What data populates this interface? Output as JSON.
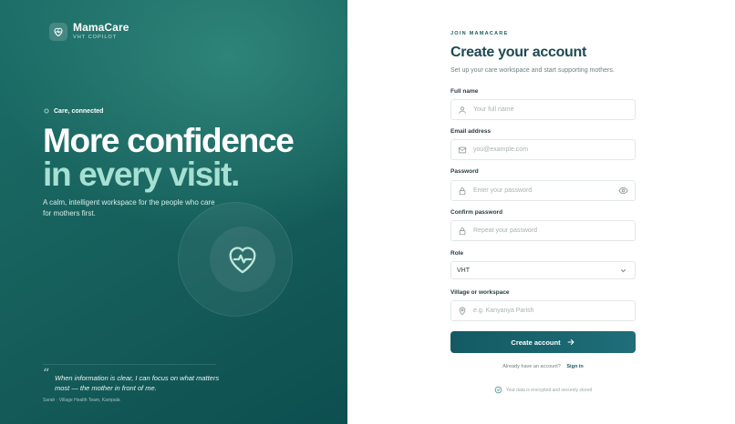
{
  "brand": {
    "name": "MamaCare",
    "subtitle": "VHT COPILOT"
  },
  "hero": {
    "eyebrow": "Care, connected",
    "headline_line1": "More confidence",
    "headline_line2": "in every visit.",
    "lead": "A calm, intelligent workspace for the people who care for mothers first.",
    "quote": "When information is clear, I can focus on what matters most — the mother in front of me.",
    "attribution": "Sarah · Village Health Team, Kampala"
  },
  "form": {
    "kicker": "JOIN MAMACARE",
    "title": "Create your account",
    "subtitle": "Set up your care workspace and start supporting mothers.",
    "full_name": {
      "label": "Full name",
      "placeholder": "Your full name"
    },
    "email": {
      "label": "Email address",
      "placeholder": "you@example.com"
    },
    "password": {
      "label": "Password",
      "placeholder": "Enter your password"
    },
    "confirm_password": {
      "label": "Confirm password",
      "placeholder": "Repeat your password"
    },
    "role": {
      "label": "Role",
      "value": "VHT"
    },
    "village": {
      "label": "Village or workspace",
      "placeholder": "e.g. Kanyanya Parish"
    },
    "submit_label": "Create account",
    "signin_prompt": "Already have an account?",
    "signin_link": "Sign in",
    "security_note": "Your data is encrypted and securely stored"
  },
  "colors": {
    "panel": "#17615d",
    "accent_text": "#a6e0d2",
    "primary": "#135a64",
    "title": "#1c4a52"
  },
  "icons": {
    "logo": "heart-pulse-icon",
    "eyebrow": "sparkle-icon",
    "full_name": "user-icon",
    "email": "mail-icon",
    "password": "lock-icon",
    "confirm_password": "lock-icon",
    "password_toggle": "eye-icon",
    "role": "chevron-down-icon",
    "village": "map-pin-icon",
    "submit": "arrow-right-icon",
    "security": "shield-check-icon"
  }
}
